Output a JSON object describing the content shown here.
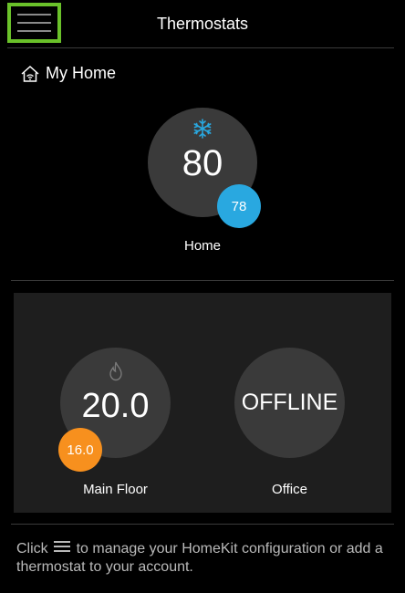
{
  "header": {
    "title": "Thermostats",
    "menu_icon": "hamburger-menu-icon"
  },
  "home_section": {
    "title": "My Home",
    "icon": "home-wifi-icon",
    "thermostats": [
      {
        "name": "Home",
        "setpoint": "80",
        "current": "78",
        "mode_icon": "snowflake-icon",
        "mode_color": "#29a8e0"
      }
    ]
  },
  "homekit_section": {
    "thermostats": [
      {
        "name": "Main Floor",
        "setpoint": "20.0",
        "current": "16.0",
        "mode_icon": "flame-icon",
        "badge_color": "#f7901e"
      },
      {
        "name": "Office",
        "status": "OFFLINE"
      }
    ]
  },
  "footer": {
    "text_before": "Click",
    "text_after": "to manage your HomeKit configuration or add a thermostat to your account."
  },
  "colors": {
    "accent_highlight": "#6ac12a",
    "cool": "#29a8e0",
    "heat": "#f7901e",
    "dial": "#3a3a3a",
    "panel": "#1e1e1e"
  }
}
